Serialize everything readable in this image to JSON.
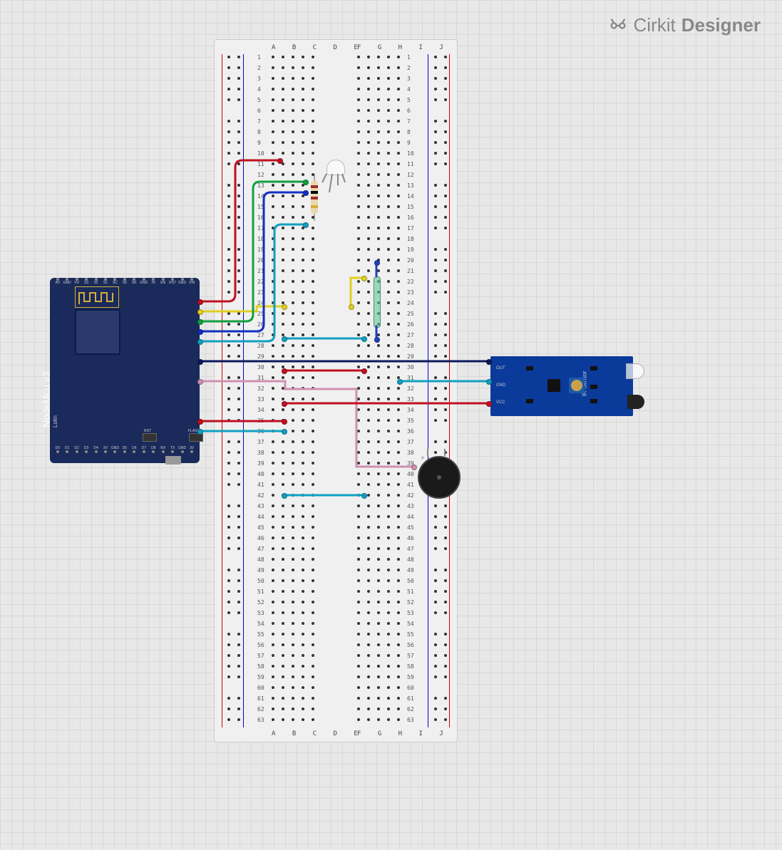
{
  "brand": {
    "name1": "Cirkit",
    "name2": "Designer"
  },
  "breadboard": {
    "columns_left": "A B C D E",
    "columns_right": "F G H I J",
    "rows": 63
  },
  "nodemcu": {
    "name": "NodeMcu v3",
    "subname": "Lolin",
    "buttons": {
      "rst": "RST",
      "flash": "FLASH"
    },
    "pins_top": [
      "A0",
      "GND",
      "VU",
      "S3",
      "S2",
      "S1",
      "SC",
      "S0",
      "SK",
      "GND",
      "3V",
      "EN",
      "RST",
      "GND",
      "VIN"
    ],
    "pins_bottom": [
      "D0",
      "D1",
      "D2",
      "D3",
      "D4",
      "3V",
      "GND",
      "D5",
      "D6",
      "D7",
      "D8",
      "RX",
      "TX",
      "GND",
      "3V"
    ]
  },
  "ir_sensor": {
    "name": "IR Sensor",
    "pins": [
      "OUT",
      "GND",
      "VCC"
    ]
  },
  "components": {
    "buzzer": "Piezo Buzzer",
    "rgb_led": "RGB LED (4-pin)",
    "resistor": "Resistor 220Ω",
    "reed": "Reed Switch"
  },
  "wires": [
    {
      "color": "#c01020",
      "desc": "D0 to row 11 (red)"
    },
    {
      "color": "#e0d020",
      "desc": "D1 to row 24 (yellow)"
    },
    {
      "color": "#10a040",
      "desc": "D2 to row 13 (green)"
    },
    {
      "color": "#1030c0",
      "desc": "D3 to row 14 (blue)"
    },
    {
      "color": "#10a0c0",
      "desc": "D4 to row 17 (teal)"
    },
    {
      "color": "#102080",
      "desc": "D5 to row 29 IR OUT (navy)"
    },
    {
      "color": "#d090b0",
      "desc": "D7 to row 32 buzzer (pink)"
    },
    {
      "color": "#10a0c0",
      "desc": "GND to row 36 (teal)"
    },
    {
      "color": "#c01020",
      "desc": "3V to row 37 (red)"
    },
    {
      "color": "#10a0c0",
      "desc": "GND IR row 31 (teal)"
    },
    {
      "color": "#c01020",
      "desc": "VCC IR row 34 (red)"
    },
    {
      "color": "#e0d020",
      "desc": "row 24 to 21 reed (yellow)"
    },
    {
      "color": "#10a0c0",
      "desc": "row 27 jumper (teal)"
    },
    {
      "color": "#c01020",
      "desc": "row 30 jumper (red)"
    },
    {
      "color": "#c01020",
      "desc": "row 33 jumper (red)"
    },
    {
      "color": "#10a0c0",
      "desc": "row 42 jumper (teal)"
    }
  ]
}
